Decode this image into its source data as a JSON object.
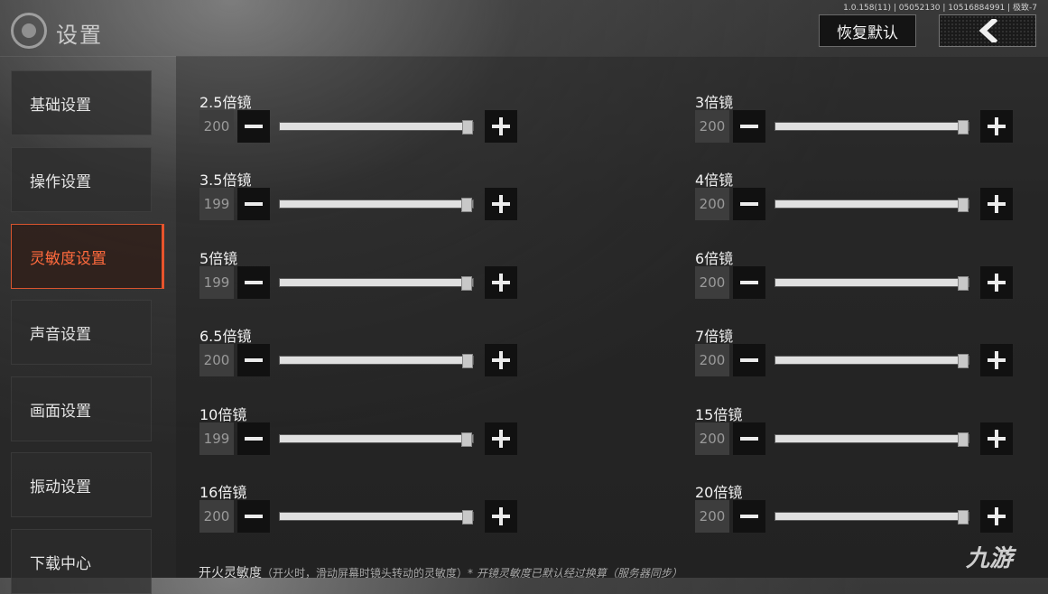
{
  "header": {
    "version": "1.0.158(11) | 05052130 | 10516884991 | 极致-7",
    "title": "设置",
    "reset_label": "恢复默认",
    "back_icon": "chevron-left-icon"
  },
  "sidebar": {
    "items": [
      {
        "label": "基础设置",
        "active": false
      },
      {
        "label": "操作设置",
        "active": false
      },
      {
        "label": "灵敏度设置",
        "active": true
      },
      {
        "label": "声音设置",
        "active": false
      },
      {
        "label": "画面设置",
        "active": false
      },
      {
        "label": "振动设置",
        "active": false
      },
      {
        "label": "下载中心",
        "active": false
      }
    ]
  },
  "sensitivity": {
    "slider_max": 200,
    "rows": [
      {
        "label": "2.5倍镜",
        "value": "200"
      },
      {
        "label": "3倍镜",
        "value": "200"
      },
      {
        "label": "3.5倍镜",
        "value": "199"
      },
      {
        "label": "4倍镜",
        "value": "200"
      },
      {
        "label": "5倍镜",
        "value": "199"
      },
      {
        "label": "6倍镜",
        "value": "200"
      },
      {
        "label": "6.5倍镜",
        "value": "200"
      },
      {
        "label": "7倍镜",
        "value": "200"
      },
      {
        "label": "10倍镜",
        "value": "199"
      },
      {
        "label": "15倍镜",
        "value": "200"
      },
      {
        "label": "16倍镜",
        "value": "200"
      },
      {
        "label": "20倍镜",
        "value": "200"
      }
    ]
  },
  "footer": {
    "title": "开火灵敏度",
    "note": "（开火时，滑动屏幕时镜头转动的灵敏度）",
    "note2": "* 开镜灵敏度已默认经过换算（服务器同步）"
  },
  "watermark": "九游",
  "colors": {
    "accent": "#e8542c",
    "active_text": "#ff6a3d"
  }
}
